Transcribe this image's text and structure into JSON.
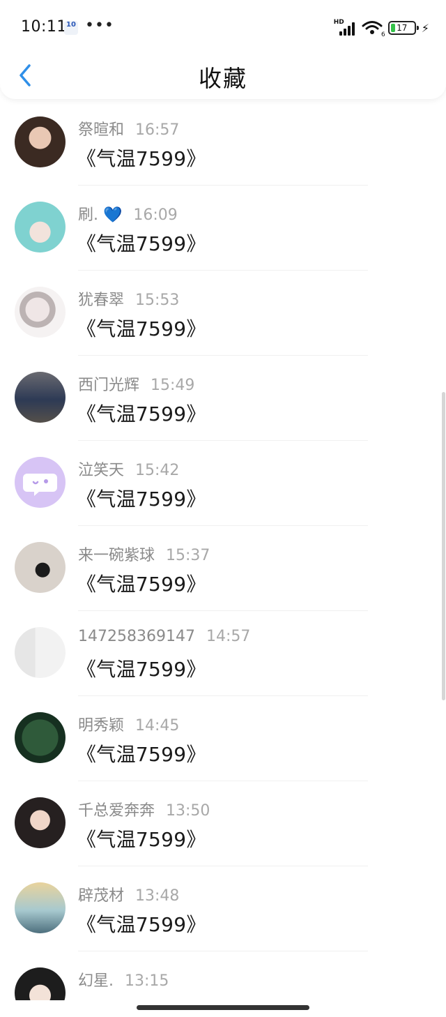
{
  "status_bar": {
    "time": "10:11",
    "app_badge": "10",
    "more": "•••",
    "signal_label": "HD",
    "wifi_label": "6",
    "battery": "17",
    "battery_level": 0.17
  },
  "header": {
    "title": "收藏",
    "back_icon": "chevron-left-icon"
  },
  "colors": {
    "accent": "#2f8fe8",
    "name_gray": "#8a8a8a",
    "time_gray": "#a8a8a8",
    "battery_green": "#35c24a"
  },
  "items": [
    {
      "name": "祭暄和",
      "time": "16:57",
      "message": "《气温7599》",
      "avatar": "avatar-face-1"
    },
    {
      "name": "刷. 💙",
      "time": "16:09",
      "message": "《气温7599》",
      "avatar": "avatar-face-2"
    },
    {
      "name": "犹春翠",
      "time": "15:53",
      "message": "《气温7599》",
      "avatar": "avatar-face-3"
    },
    {
      "name": "西门光辉",
      "time": "15:49",
      "message": "《气温7599》",
      "avatar": "avatar-face-4"
    },
    {
      "name": "泣笑天",
      "time": "15:42",
      "message": "《气温7599》",
      "avatar": "avatar-chat-bubble"
    },
    {
      "name": "来一碗紫球",
      "time": "15:37",
      "message": "《气温7599》",
      "avatar": "avatar-face-5"
    },
    {
      "name": "147258369147",
      "time": "14:57",
      "message": "《气温7599》",
      "avatar": "avatar-door"
    },
    {
      "name": "明秀颖",
      "time": "14:45",
      "message": "《气温7599》",
      "avatar": "avatar-text-image"
    },
    {
      "name": "千总爱奔奔",
      "time": "13:50",
      "message": "《气温7599》",
      "avatar": "avatar-face-6"
    },
    {
      "name": "辟茂材",
      "time": "13:48",
      "message": "《气温7599》",
      "avatar": "avatar-beach"
    },
    {
      "name": "幻星.",
      "time": "13:15",
      "message": "",
      "avatar": "avatar-face-7"
    }
  ]
}
